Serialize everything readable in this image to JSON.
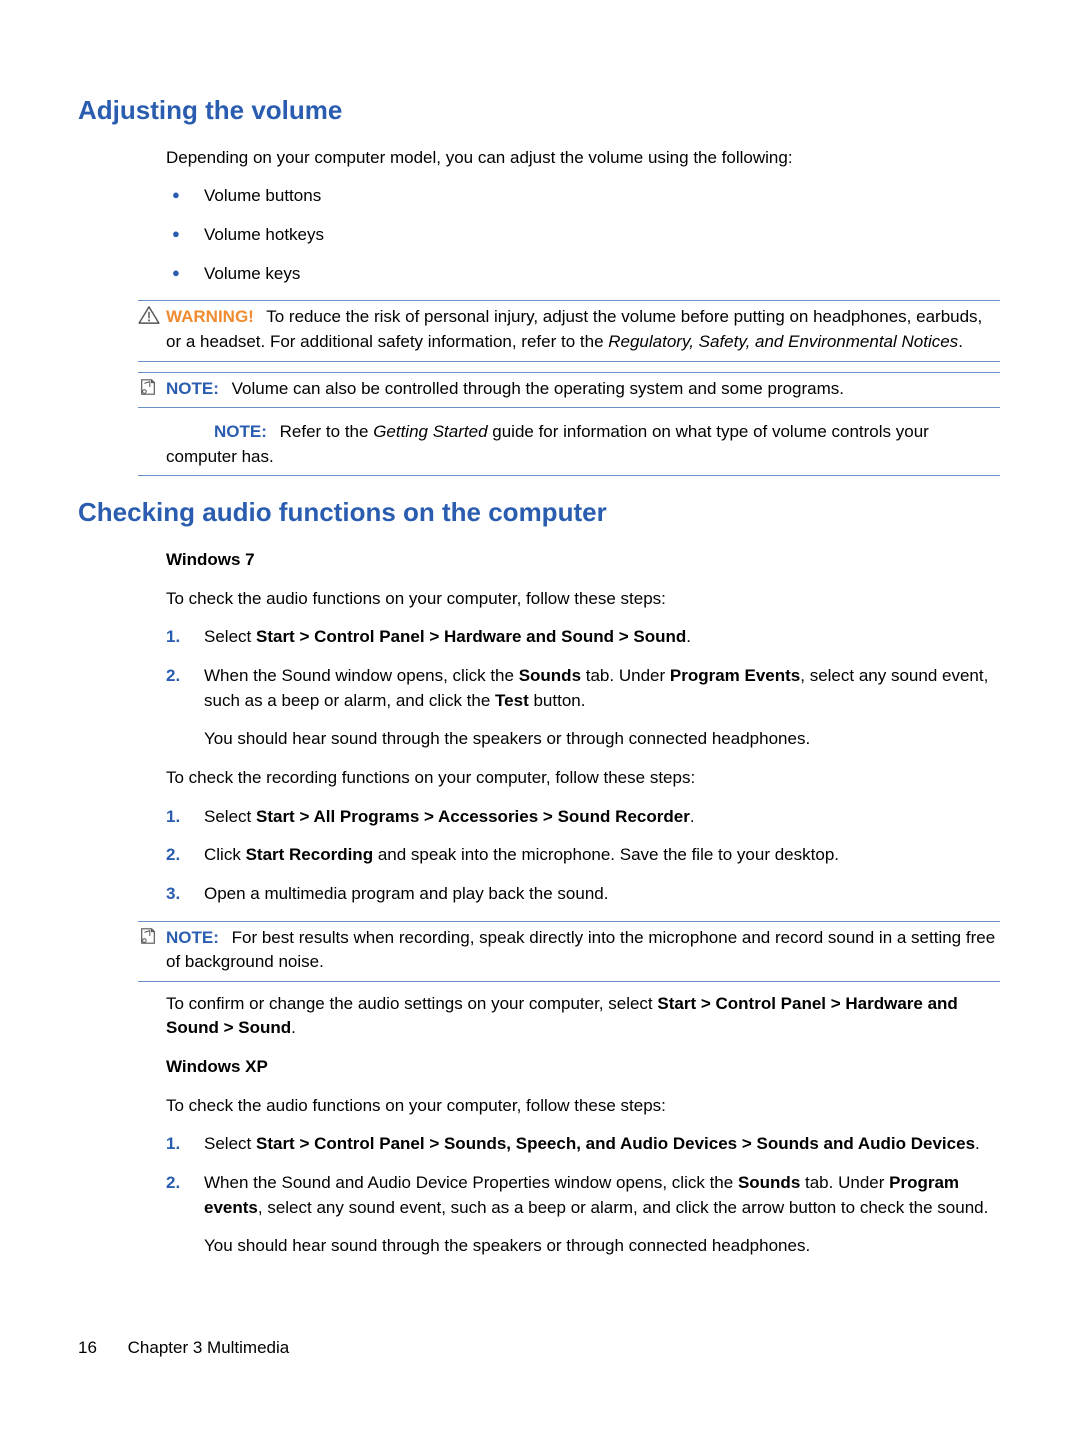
{
  "headings": {
    "h2_volume": "Adjusting the volume",
    "h2_audio_check": "Checking audio functions on the computer"
  },
  "volume": {
    "intro": "Depending on your computer model, you can adjust the volume using the following:",
    "bullets": [
      "Volume buttons",
      "Volume hotkeys",
      "Volume keys"
    ]
  },
  "callouts": {
    "warning_label": "WARNING!",
    "warning_text_a": "To reduce the risk of personal injury, adjust the volume before putting on headphones, earbuds, or a headset. For additional safety information, refer to the ",
    "warning_text_italic": "Regulatory, Safety, and Environmental Notices",
    "warning_text_b": ".",
    "note_label": "NOTE:",
    "note1_text": "Volume can also be controlled through the operating system and some programs.",
    "note2_text_a": "Refer to the ",
    "note2_text_italic": "Getting Started",
    "note2_text_b": " guide for information on what type of volume controls your computer has.",
    "note3_text": "For best results when recording, speak directly into the microphone and record sound in a setting free of background noise."
  },
  "win7": {
    "subhead": "Windows 7",
    "check_intro": "To check the audio functions on your computer, follow these steps:",
    "steps_a": [
      {
        "num": "1.",
        "pre": "Select ",
        "bold": "Start > Control Panel > Hardware and Sound > Sound",
        "post": "."
      },
      {
        "num": "2.",
        "p1_pre": "When the Sound window opens, click the ",
        "p1_b1": "Sounds",
        "p1_mid1": " tab. Under ",
        "p1_b2": "Program Events",
        "p1_mid2": ", select any sound event, such as a beep or alarm, and click the ",
        "p1_b3": "Test",
        "p1_post": " button.",
        "p2": "You should hear sound through the speakers or through connected headphones."
      }
    ],
    "rec_intro": "To check the recording functions on your computer, follow these steps:",
    "steps_b": [
      {
        "num": "1.",
        "pre": "Select ",
        "bold": "Start > All Programs > Accessories > Sound Recorder",
        "post": "."
      },
      {
        "num": "2.",
        "pre": "Click ",
        "bold": "Start Recording",
        "post": " and speak into the microphone. Save the file to your desktop."
      },
      {
        "num": "3.",
        "text": "Open a multimedia program and play back the sound."
      }
    ],
    "confirm_pre": "To confirm or change the audio settings on your computer, select ",
    "confirm_bold": "Start > Control Panel > Hardware and Sound > Sound",
    "confirm_post": "."
  },
  "winxp": {
    "subhead": "Windows XP",
    "check_intro": "To check the audio functions on your computer, follow these steps:",
    "steps": [
      {
        "num": "1.",
        "pre": "Select ",
        "bold": "Start > Control Panel > Sounds, Speech, and Audio Devices > Sounds and Audio Devices",
        "post": "."
      },
      {
        "num": "2.",
        "p1_pre": "When the Sound and Audio Device Properties window opens, click the ",
        "p1_b1": "Sounds",
        "p1_mid1": " tab. Under ",
        "p1_b2": "Program events",
        "p1_post": ", select any sound event, such as a beep or alarm, and click the arrow button to check the sound.",
        "p2": "You should hear sound through the speakers or through connected headphones."
      }
    ]
  },
  "footer": {
    "page_number": "16",
    "chapter": "Chapter 3   Multimedia"
  }
}
